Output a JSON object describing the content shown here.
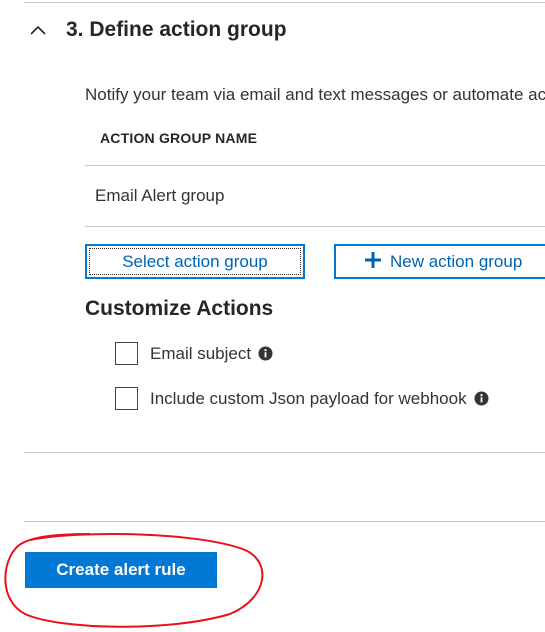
{
  "section": {
    "title": "3. Define action group",
    "description": "Notify your team via email and text messages or automate actions using webhooks, runbooks, functions, logic apps or integrating with external ITSM solutions."
  },
  "table": {
    "header": "ACTION GROUP NAME",
    "rows": [
      {
        "name": "Email Alert group"
      }
    ]
  },
  "buttons": {
    "select_action_group": "Select action group",
    "new_action_group": "New action group",
    "create_alert_rule": "Create alert rule"
  },
  "customize": {
    "title": "Customize Actions",
    "options": [
      {
        "label": "Email subject",
        "checked": false
      },
      {
        "label": "Include custom Json payload for webhook",
        "checked": false
      }
    ]
  },
  "colors": {
    "accent": "#0078d4",
    "annotation": "#e8121c"
  }
}
